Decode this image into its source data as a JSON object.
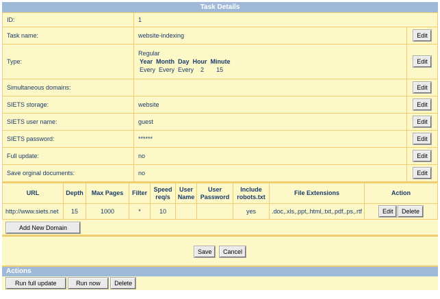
{
  "title": "Task Details",
  "details": {
    "id_label": "ID:",
    "id_value": "1",
    "task_name_label": "Task name:",
    "task_name_value": "website-indexing",
    "type_label": "Type:",
    "type_value": "Regular",
    "schedule_headers": [
      "Year",
      "Month",
      "Day",
      "Hour",
      "Minute"
    ],
    "schedule_values": [
      "Every",
      "Every",
      "Every",
      "2",
      "15"
    ],
    "simultaneous_domains_label": "Simultaneous domains:",
    "simultaneous_domains_value": "",
    "storage_label": "SIETS storage:",
    "storage_value": "website",
    "user_name_label": "SIETS user name:",
    "user_name_value": "guest",
    "password_label": "SIETS password:",
    "password_value": "******",
    "full_update_label": "Full update:",
    "full_update_value": "no",
    "save_docs_label": "Save orginal documents:",
    "save_docs_value": "no",
    "edit_label": "Edit"
  },
  "domains": {
    "columns": [
      "URL",
      "Depth",
      "Max Pages",
      "Filter",
      "Speed req/s",
      "User Name",
      "User Password",
      "Include robots.txt",
      "File Extensions",
      "Action"
    ],
    "rows": [
      {
        "url": "http://www.siets.net",
        "depth": "15",
        "max_pages": "1000",
        "filter": "*",
        "speed": "10",
        "user_name": "",
        "user_password": "",
        "robots": "yes",
        "extensions": ".doc,.xls,.ppt,.html,.txt,.pdf,.ps,.rtf"
      }
    ],
    "edit_label": "Edit",
    "delete_label": "Delete",
    "add_label": "Add New Domain"
  },
  "form": {
    "save_label": "Save",
    "cancel_label": "Cancel"
  },
  "actions": {
    "title": "Actions",
    "run_full_label": "Run full update",
    "run_now_label": "Run now",
    "delete_label": "Delete"
  },
  "colors": {
    "header_bar": "#9fb9d8",
    "row_bg": "#fdf8c8",
    "border": "#f0cd6e",
    "text": "#1a3a6a"
  }
}
